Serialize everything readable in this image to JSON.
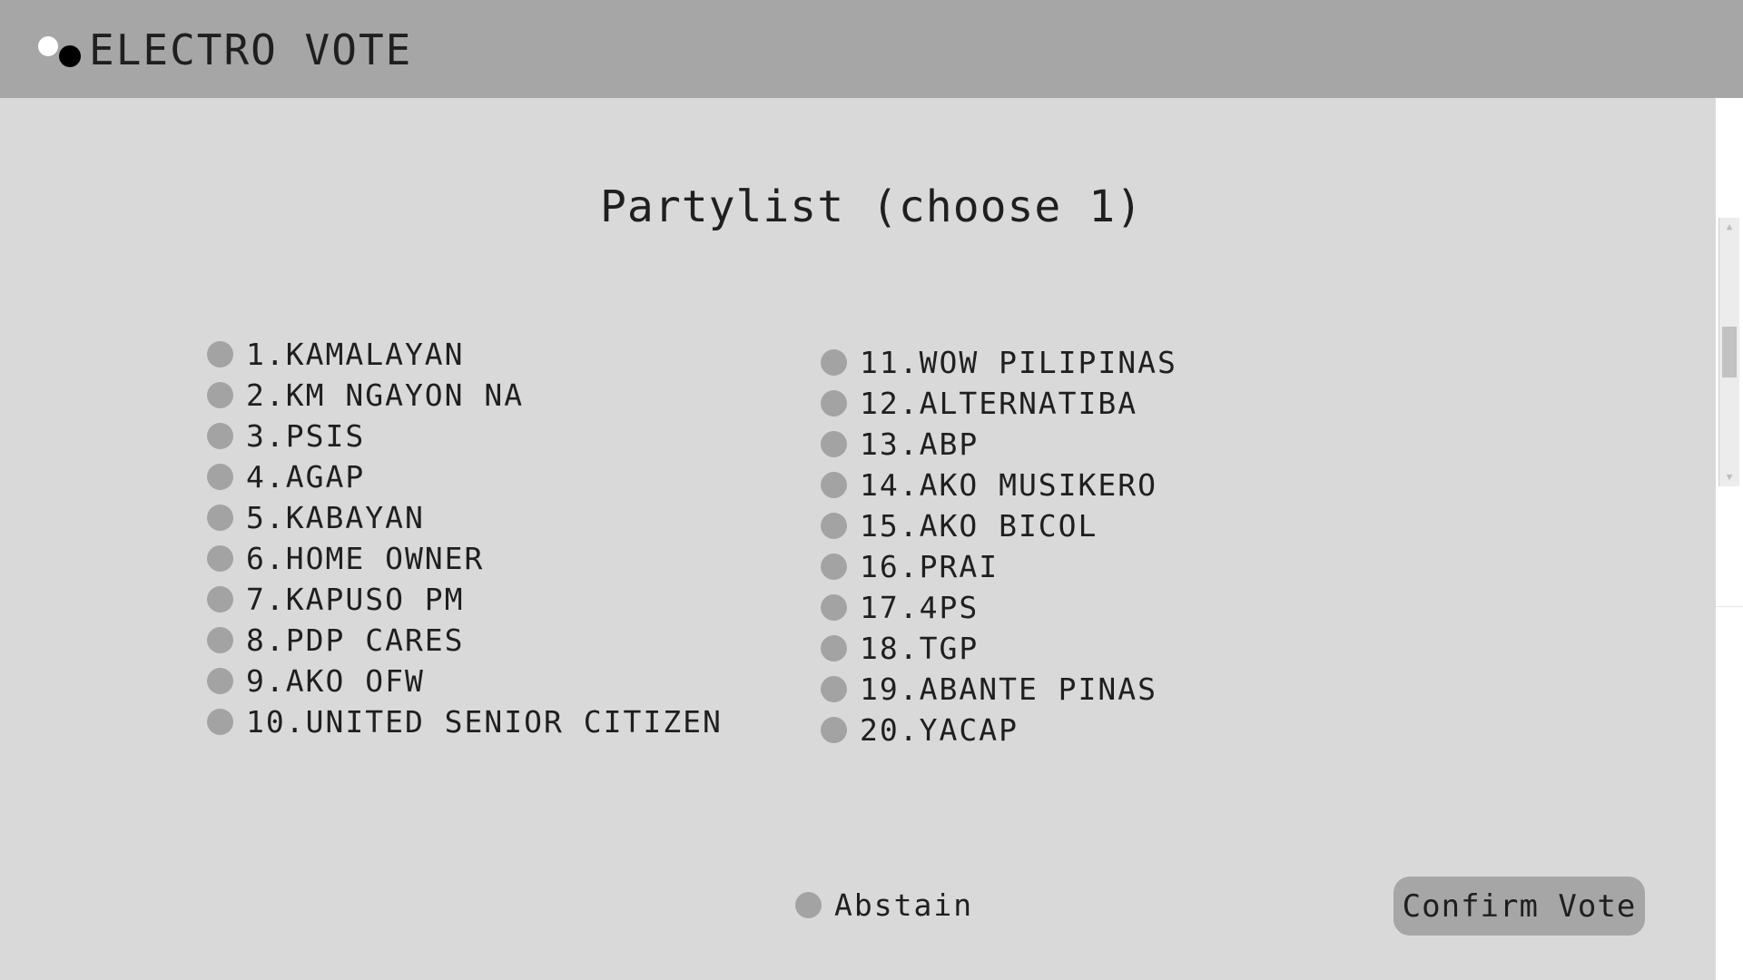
{
  "app": {
    "title": "ELECTRO VOTE"
  },
  "page": {
    "title": "Partylist (choose 1)"
  },
  "options_left": [
    {
      "label": "1.KAMALAYAN"
    },
    {
      "label": "2.KM NGAYON NA"
    },
    {
      "label": "3.PSIS"
    },
    {
      "label": "4.AGAP"
    },
    {
      "label": "5.KABAYAN"
    },
    {
      "label": "6.HOME OWNER"
    },
    {
      "label": "7.KAPUSO PM"
    },
    {
      "label": "8.PDP CARES"
    },
    {
      "label": "9.AKO OFW"
    },
    {
      "label": "10.UNITED SENIOR CITIZEN"
    }
  ],
  "options_right": [
    {
      "label": "11.WOW PILIPINAS"
    },
    {
      "label": "12.ALTERNATIBA"
    },
    {
      "label": "13.ABP"
    },
    {
      "label": "14.AKO MUSIKERO"
    },
    {
      "label": "15.AKO BICOL"
    },
    {
      "label": "16.PRAI"
    },
    {
      "label": "17.4PS"
    },
    {
      "label": "18.TGP"
    },
    {
      "label": "19.ABANTE PINAS"
    },
    {
      "label": "20.YACAP"
    }
  ],
  "abstain": {
    "label": "Abstain"
  },
  "actions": {
    "confirm_label": "Confirm Vote"
  },
  "colors": {
    "header_bg": "#a6a6a6",
    "content_bg": "#d9d9d9",
    "radio": "#a3a3a3",
    "button_bg": "#a6a6a6"
  },
  "icons": {
    "logo": "two-dots-logo-icon",
    "radio": "radio-circle-icon"
  }
}
